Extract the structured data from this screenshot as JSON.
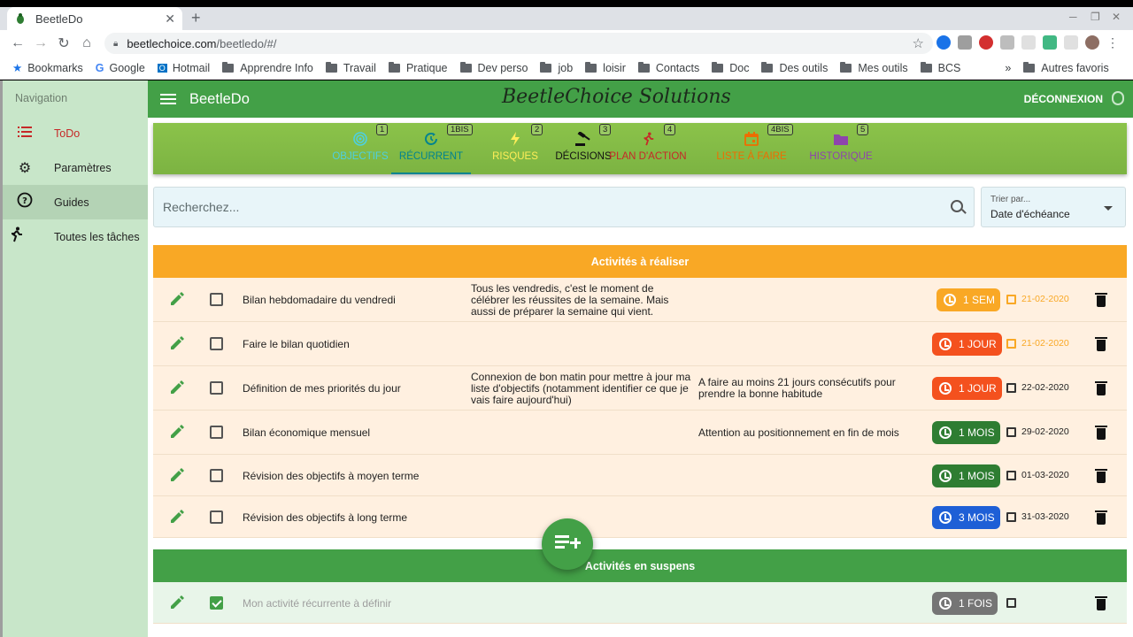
{
  "browser": {
    "tab_title": "BeetleDo",
    "url_domain": "beetlechoice.com",
    "url_path": "/beetledo/#/",
    "bookmarks": [
      "Bookmarks",
      "Google",
      "Hotmail",
      "Apprendre Info",
      "Travail",
      "Pratique",
      "Dev perso",
      "job",
      "loisir",
      "Contacts",
      "Doc",
      "Des outils",
      "Mes outils",
      "BCS"
    ],
    "more_bookmarks": "»",
    "other_bookmarks": "Autres favoris"
  },
  "sidebar": {
    "heading": "Navigation",
    "items": [
      {
        "label": "ToDo",
        "icon": "list-icon",
        "color": "#c62828"
      },
      {
        "label": "Paramètres",
        "icon": "gear-icon",
        "color": "#222"
      },
      {
        "label": "Guides",
        "icon": "help-circle-icon",
        "color": "#222"
      },
      {
        "label": "Toutes les tâches",
        "icon": "running-person-icon",
        "color": "#222"
      }
    ]
  },
  "appbar": {
    "title": "BeetleDo",
    "brand": "BeetleChoice Solutions",
    "logout": "DÉCONNEXION"
  },
  "tabs": [
    {
      "label": "OBJECTIFS",
      "badge": "1",
      "color": "#4dd0e1",
      "icon": "target-icon"
    },
    {
      "label": "RÉCURRENT",
      "badge": "1BIS",
      "color": "#00838f",
      "icon": "recurrent-icon"
    },
    {
      "label": "RISQUES",
      "badge": "2",
      "color": "#ffee58",
      "icon": "lightning-icon"
    },
    {
      "label": "DÉCISIONS",
      "badge": "3",
      "color": "#111111",
      "icon": "gavel-icon"
    },
    {
      "label": "PLAN D'ACTION",
      "badge": "4",
      "color": "#c62828",
      "icon": "running-person-icon"
    },
    {
      "label": "LISTE À FAIRE",
      "badge": "4BIS",
      "color": "#ef6c00",
      "icon": "calendar-icon"
    },
    {
      "label": "HISTORIQUE",
      "badge": "5",
      "color": "#8e44ad",
      "icon": "folder-icon"
    }
  ],
  "search": {
    "placeholder": "Recherchez..."
  },
  "sort": {
    "label": "Trier par...",
    "value": "Date d'échéance"
  },
  "sections": {
    "todo": "Activités à réaliser",
    "pending": "Activités en suspens"
  },
  "colors": {
    "todo_header": "#f9a825",
    "pending_header": "#43a047",
    "chip_sem": "#f9a825",
    "chip_jour": "#f4511e",
    "chip_mois": "#2e7d32",
    "chip_3mois": "#1e5fd6",
    "chip_fois": "#757575"
  },
  "todo_rows": [
    {
      "title": "Bilan hebdomadaire du vendredi",
      "desc": "Tous les vendredis, c'est le moment de célébrer les réussites de la semaine. Mais aussi de préparer la semaine qui vient.",
      "note": "",
      "chip": "1 SEM",
      "chip_color": "#f9a825",
      "date": "21-02-2020",
      "date_color": "#f9a825"
    },
    {
      "title": "Faire le bilan quotidien",
      "desc": "",
      "note": "",
      "chip": "1 JOUR",
      "chip_color": "#f4511e",
      "date": "21-02-2020",
      "date_color": "#f9a825"
    },
    {
      "title": "Définition de mes priorités du jour",
      "desc": "Connexion de bon matin pour mettre à jour ma liste d'objectifs (notamment identifier ce que je vais faire aujourd'hui)",
      "note": "A faire au moins 21 jours consécutifs pour prendre la bonne habitude",
      "chip": "1 JOUR",
      "chip_color": "#f4511e",
      "date": "22-02-2020",
      "date_color": "#222222"
    },
    {
      "title": "Bilan économique mensuel",
      "desc": "",
      "note": "Attention au positionnement en fin de mois",
      "chip": "1 MOIS",
      "chip_color": "#2e7d32",
      "date": "29-02-2020",
      "date_color": "#222222"
    },
    {
      "title": "Révision des objectifs à moyen terme",
      "desc": "",
      "note": "",
      "chip": "1 MOIS",
      "chip_color": "#2e7d32",
      "date": "01-03-2020",
      "date_color": "#222222"
    },
    {
      "title": "Révision des objectifs à long terme",
      "desc": "",
      "note": "",
      "chip": "3 MOIS",
      "chip_color": "#1e5fd6",
      "date": "31-03-2020",
      "date_color": "#222222"
    }
  ],
  "pending_rows": [
    {
      "title": "Mon activité récurrente à définir",
      "chip": "1 FOIS",
      "chip_color": "#757575",
      "checked": true
    }
  ]
}
